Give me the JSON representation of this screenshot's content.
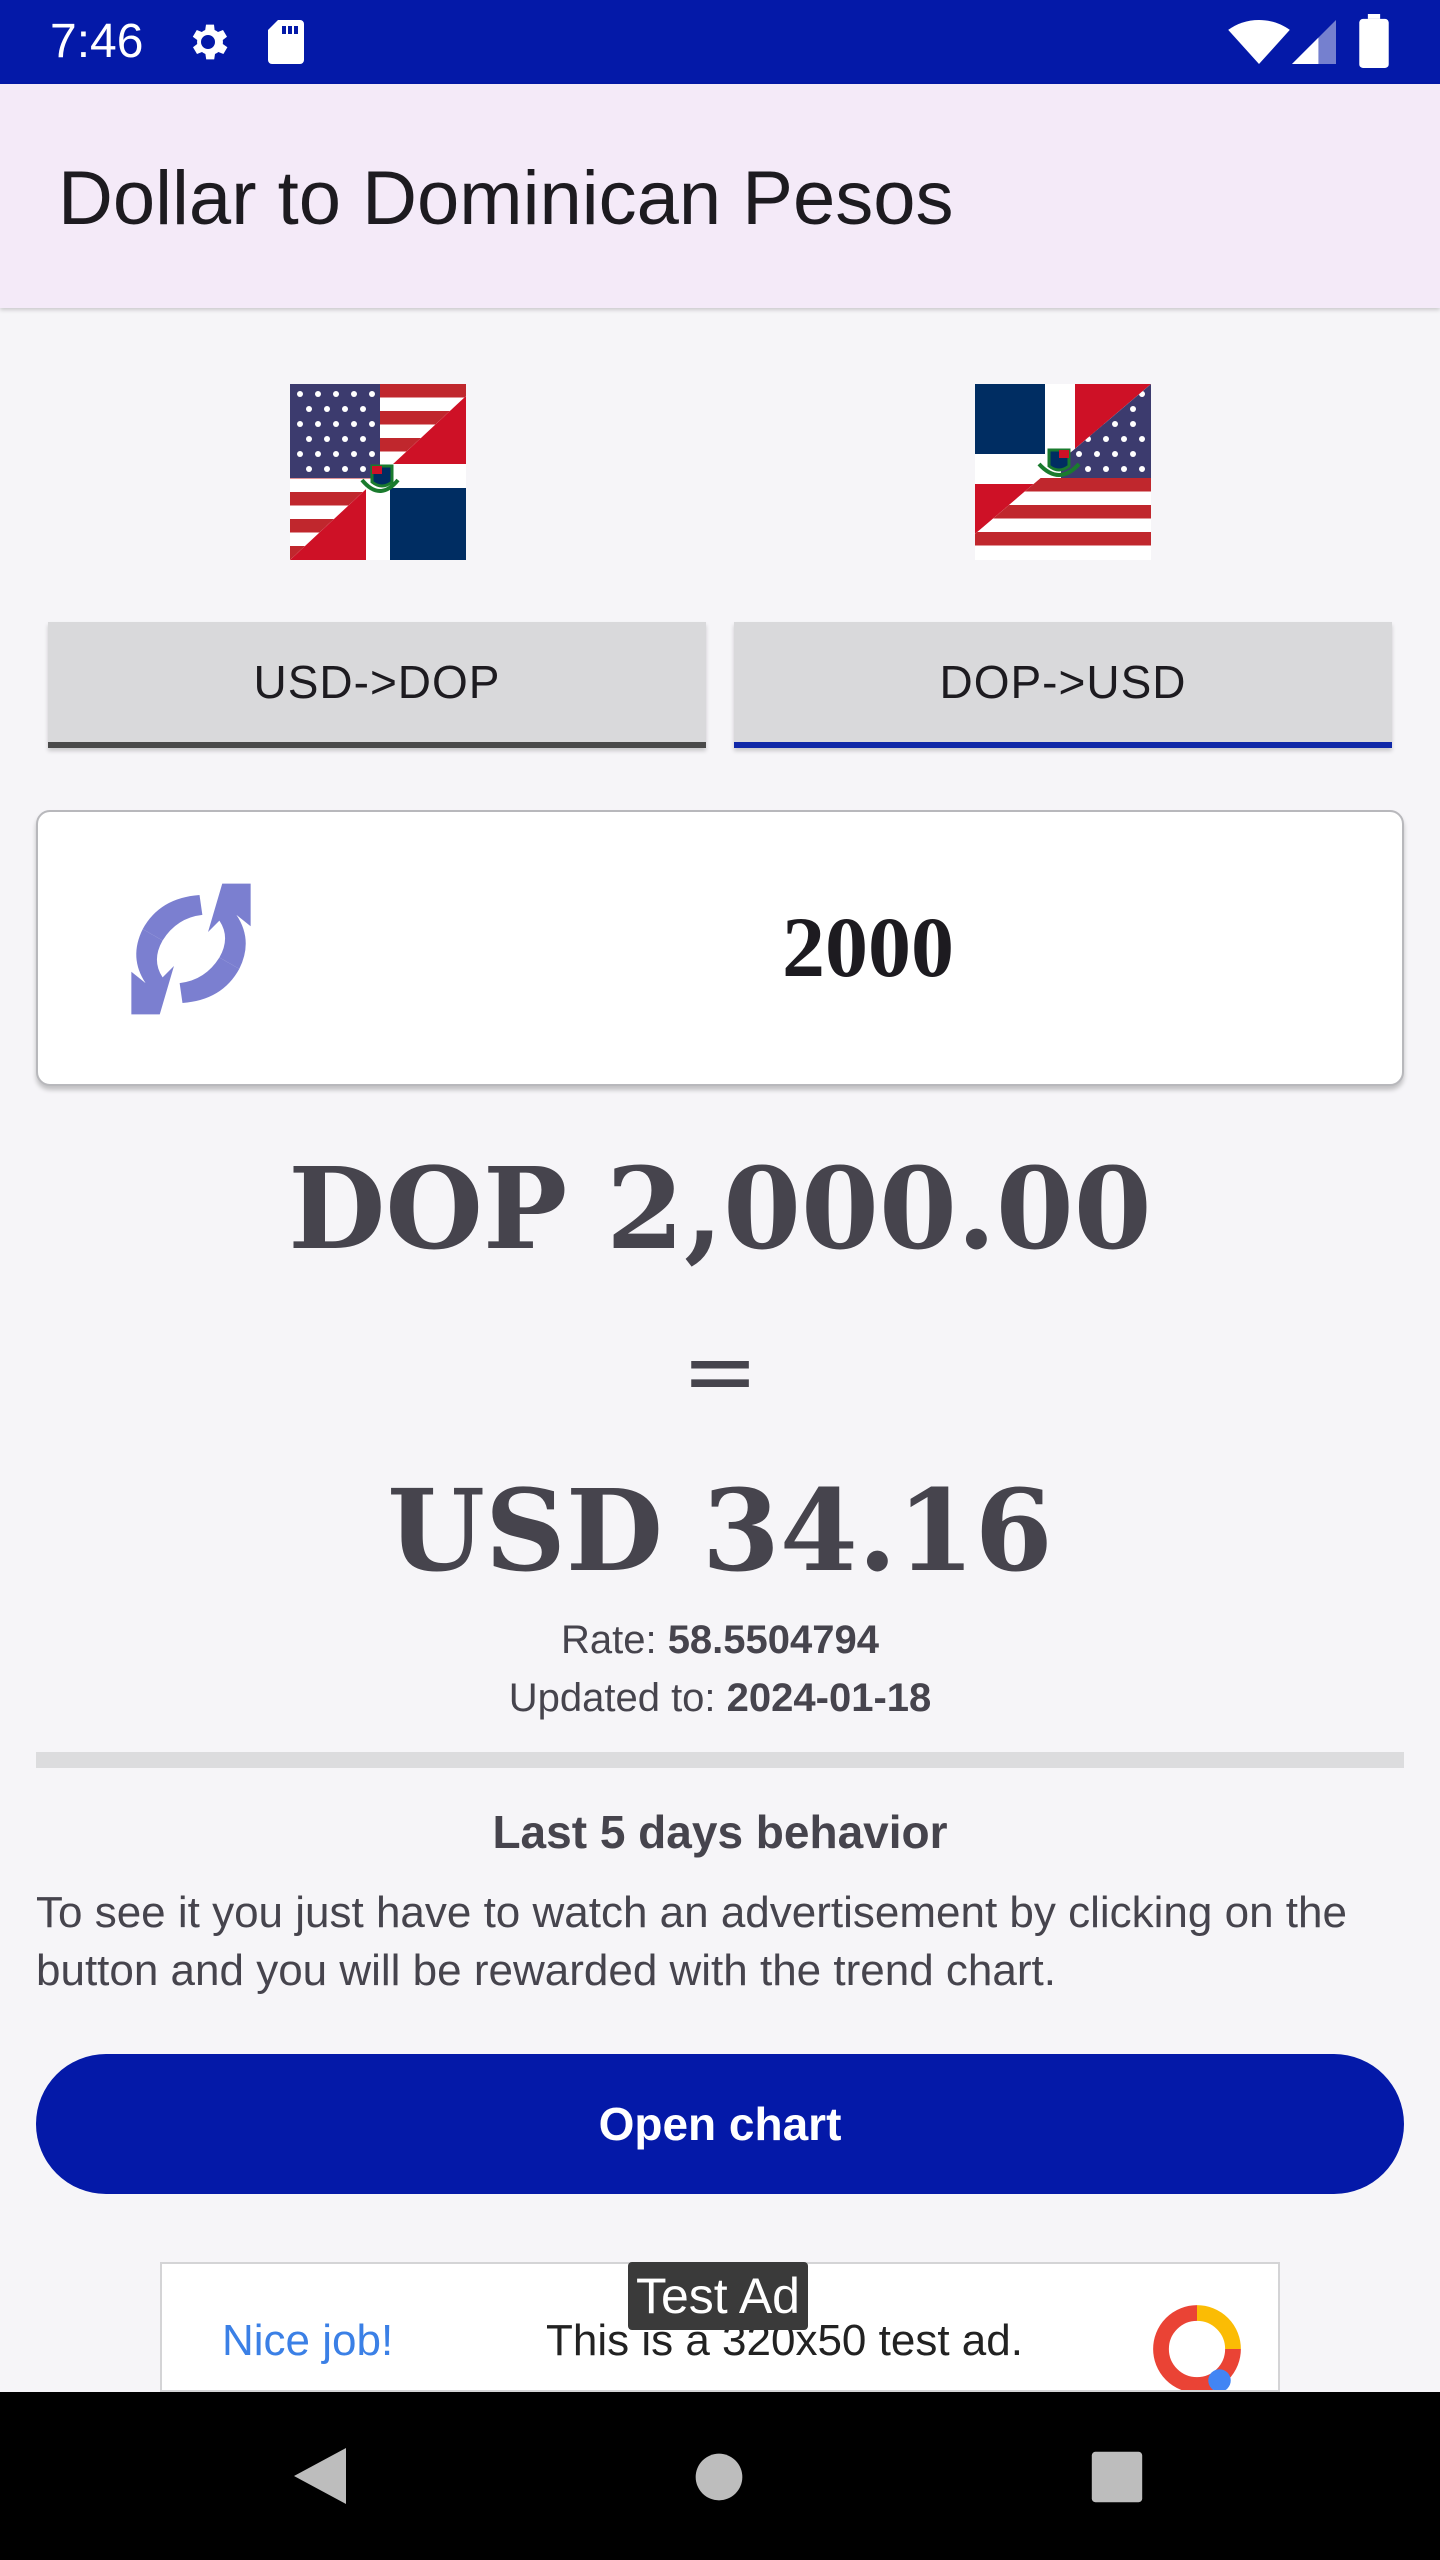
{
  "status_bar": {
    "time": "7:46",
    "icons": [
      "gear-icon",
      "sd-card-icon",
      "wifi-icon",
      "signal-icon",
      "battery-icon"
    ],
    "background": "#0419a8"
  },
  "app_bar": {
    "title": "Dollar to Dominican Pesos"
  },
  "mode_buttons": {
    "usd_dop": "USD->DOP",
    "dop_usd": "DOP->USD",
    "selected": "DOP->USD"
  },
  "amount_card": {
    "value": "2000",
    "icon": "swap-icon"
  },
  "result": {
    "from": "DOP 2,000.00",
    "equals": "=",
    "to": "USD 34.16"
  },
  "rate": {
    "label": "Rate: ",
    "value": "58.5504794"
  },
  "updated": {
    "label": "Updated to: ",
    "value": "2024-01-18"
  },
  "trend": {
    "title": "Last 5 days behavior",
    "description": "To see it you just have to watch an advertisement by clicking on the button and you will be rewarded with the trend chart."
  },
  "open_chart_label": "Open chart",
  "ad": {
    "tag": "Test Ad",
    "nice": "Nice job!",
    "text": "This is a 320x50 test ad."
  },
  "colors": {
    "primary": "#0419a8",
    "app_bar": "#f4eaf8",
    "swap_icon": "#7b7fd0",
    "text_dark": "#46444d"
  }
}
